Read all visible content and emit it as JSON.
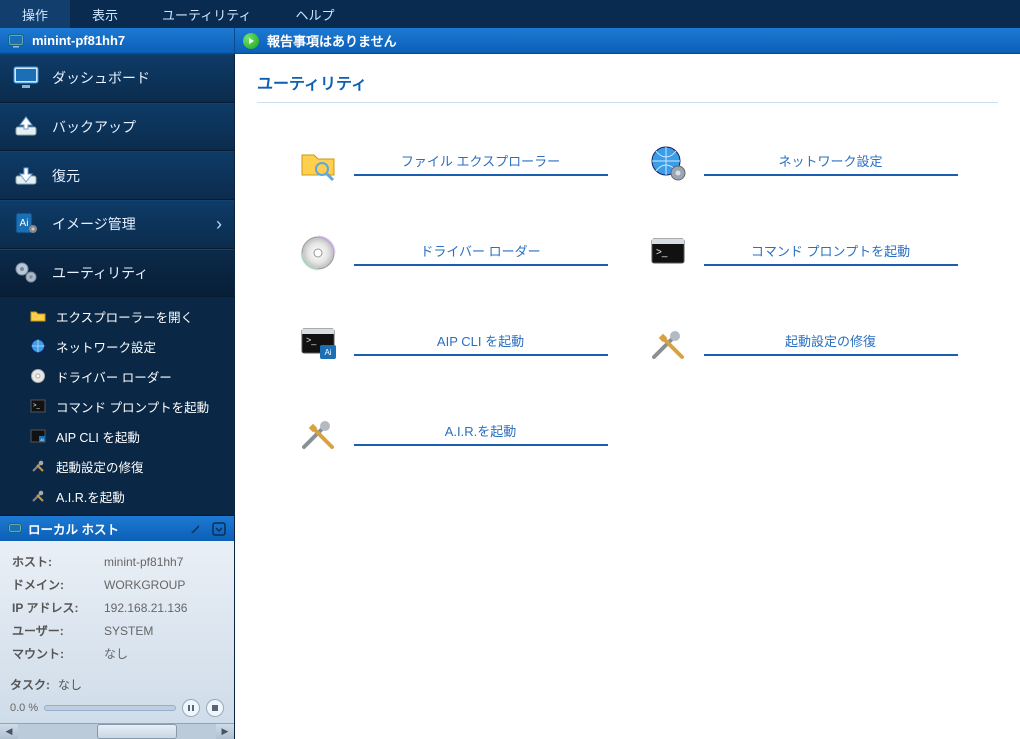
{
  "menubar": {
    "items": [
      "操作",
      "表示",
      "ユーティリティ",
      "ヘルプ"
    ]
  },
  "infobar": {
    "host": "minint-pf81hh7",
    "status": "報告事項はありません"
  },
  "sidebar": {
    "nav": [
      {
        "id": "dashboard",
        "label": "ダッシュボード"
      },
      {
        "id": "backup",
        "label": "バックアップ"
      },
      {
        "id": "restore",
        "label": "復元"
      },
      {
        "id": "image",
        "label": "イメージ管理",
        "has_chevron": true
      },
      {
        "id": "utilities",
        "label": "ユーティリティ",
        "selected": true
      }
    ],
    "sub_items": [
      {
        "id": "open-explorer",
        "label": "エクスプローラーを開く"
      },
      {
        "id": "network-settings",
        "label": "ネットワーク設定"
      },
      {
        "id": "driver-loader",
        "label": "ドライバー ローダー"
      },
      {
        "id": "launch-cmd",
        "label": "コマンド プロンプトを起動"
      },
      {
        "id": "launch-aip-cli",
        "label": "AIP CLI を起動"
      },
      {
        "id": "repair-boot",
        "label": "起動設定の修復"
      },
      {
        "id": "launch-air",
        "label": "A.I.R.を起動"
      }
    ]
  },
  "localhost": {
    "title": "ローカル ホスト",
    "rows": [
      {
        "k": "ホスト:",
        "v": "minint-pf81hh7"
      },
      {
        "k": "ドメイン:",
        "v": "WORKGROUP"
      },
      {
        "k": "IP アドレス:",
        "v": "192.168.21.136"
      },
      {
        "k": "ユーザー:",
        "v": "SYSTEM"
      },
      {
        "k": "マウント:",
        "v": "なし"
      }
    ],
    "task_label": "タスク:",
    "task_value": "なし",
    "progress_text": "0.0 %"
  },
  "content": {
    "title": "ユーティリティ",
    "utilities": [
      {
        "id": "file-explorer",
        "label": "ファイル エクスプローラー",
        "icon": "folder"
      },
      {
        "id": "network-settings",
        "label": "ネットワーク設定",
        "icon": "globe"
      },
      {
        "id": "driver-loader",
        "label": "ドライバー ローダー",
        "icon": "disc"
      },
      {
        "id": "launch-cmd",
        "label": "コマンド プロンプトを起動",
        "icon": "terminal"
      },
      {
        "id": "launch-aip-cli",
        "label": "AIP CLI を起動",
        "icon": "terminal-ai"
      },
      {
        "id": "repair-boot",
        "label": "起動設定の修復",
        "icon": "tools"
      },
      {
        "id": "launch-air",
        "label": "A.I.R.を起動",
        "icon": "tools"
      }
    ]
  }
}
